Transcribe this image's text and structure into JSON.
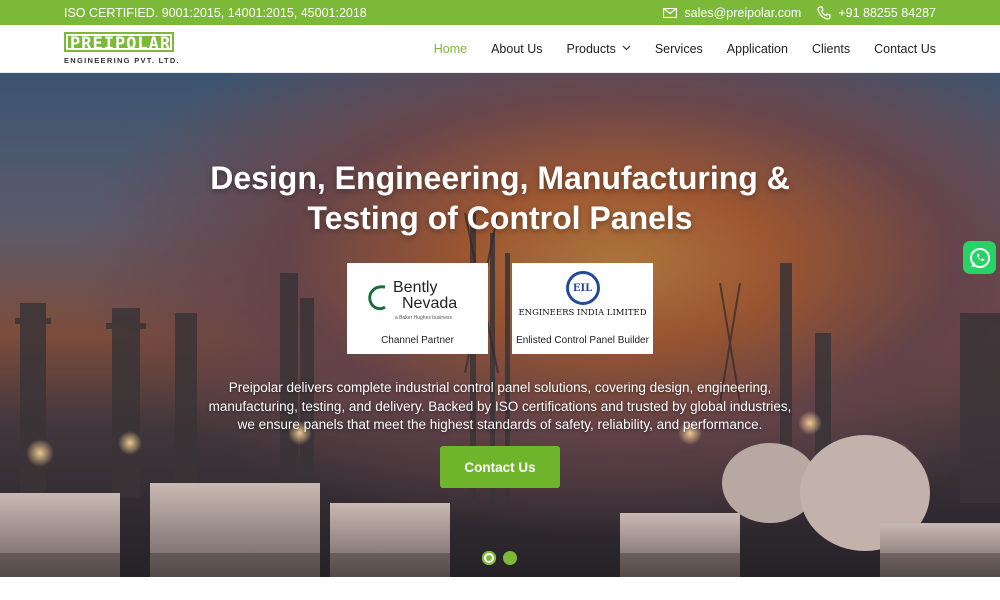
{
  "topbar": {
    "iso_text": "ISO CERTIFIED.  9001:2015, 14001:2015, 45001:2018",
    "email": "sales@preipolar.com",
    "phone": "+91 88255 84287",
    "email_icon": "mail-icon",
    "phone_icon": "phone-icon"
  },
  "brand": {
    "logo_text": "PREIPOLAR",
    "tagline": "ENGINEERING PVT. LTD.",
    "accent": "#7cb938"
  },
  "nav": {
    "items": [
      {
        "label": "Home",
        "active": true
      },
      {
        "label": "About Us"
      },
      {
        "label": "Products",
        "has_dropdown": true
      },
      {
        "label": "Services"
      },
      {
        "label": "Application"
      },
      {
        "label": "Clients"
      },
      {
        "label": "Contact Us"
      }
    ]
  },
  "hero": {
    "title_line1": "Design, Engineering, Manufacturing &",
    "title_line2": "Testing of Control Panels",
    "partners": [
      {
        "name_line1": "Bently",
        "name_line2": "Nevada",
        "sub": "a Baker Hughes business",
        "caption": "Channel Partner"
      },
      {
        "logo_text": "EIL",
        "name": "ENGINEERS INDIA LIMITED",
        "caption": "Enlisted Control Panel Builder"
      }
    ],
    "desc_line1": "Preipolar delivers complete industrial control panel solutions, covering design, engineering,",
    "desc_line2": "manufacturing, testing, and delivery. Backed by ISO certifications and trusted by global industries,",
    "desc_line3": "we ensure panels that meet the highest standards of safety, reliability, and performance.",
    "cta_label": "Contact Us",
    "slides": {
      "count": 2,
      "active": 1
    }
  },
  "floating": {
    "whatsapp_icon": "whatsapp-icon"
  }
}
